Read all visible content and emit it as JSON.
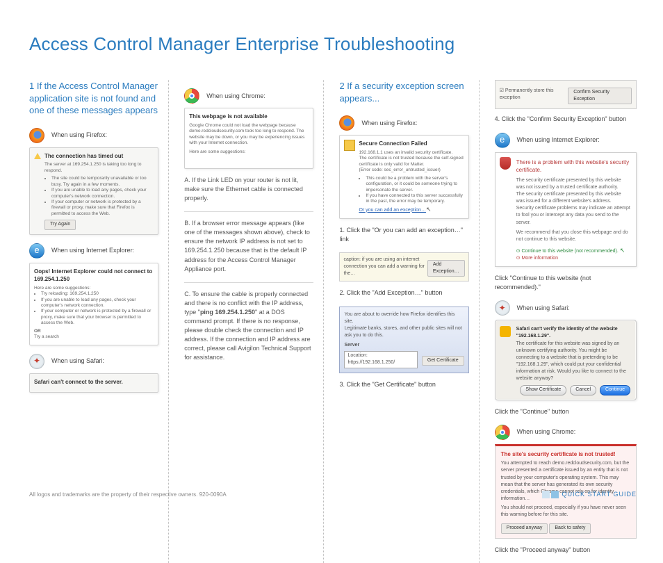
{
  "title": "Access Control Manager Enterprise Troubleshooting",
  "sec1": {
    "heading": "1 If the Access Control Manager application site is not found and one of these messages appears",
    "firefox_label": "When using Firefox:",
    "ie_label": "When using Internet Explorer:",
    "safari_label": "When using Safari:",
    "ff_shot_title": "The connection has timed out",
    "ff_shot_body": "The server at 169.254.1.250 is taking too long to respond.",
    "ff_shot_bul1": "The site could be temporarily unavailable or too busy. Try again in a few moments.",
    "ff_shot_bul2": "If you are unable to load any pages, check your computer's network connection.",
    "ff_shot_bul3": "If your computer or network is protected by a firewall or proxy, make sure that Firefox is permitted to access the Web.",
    "ff_shot_btn": "Try Again",
    "ie_shot_title": "Oops! Internet Explorer could not connect to 169.254.1.250",
    "ie_shot_sub": "Here are some suggestions:",
    "ie_shot_b1": "Try reloading: 169.254.1.250",
    "ie_shot_b2": "If you are unable to load any pages, check your computer's network connection.",
    "ie_shot_b3": "If your computer or network is protected by a firewall or proxy, make sure that your browser is permitted to access the Web.",
    "ie_shot_or": "OR",
    "ie_shot_try": "Try a search",
    "safari_shot_title": "Safari can't connect to the server."
  },
  "col2": {
    "chrome_label": "When using Chrome:",
    "cr_shot_title": "This webpage is not available",
    "cr_shot_body": "Google Chrome could not load the webpage because demo.redcloudsecurity.com took too long to respond. The website may be down, or you may be experiencing issues with your Internet connection.",
    "cr_shot_sub": "Here are some suggestions:",
    "noteA": "A.  If the Link LED on your router is not lit, make sure the Ethernet cable is connected properly.",
    "noteB": "B.  If a browser error message appears (like one of the messages shown above), check to ensure the network IP address is not set to 169.254.1.250 because that is the default IP address for the Access Control Manager Appliance port.",
    "noteC_pre": "C. To ensure the cable is properly connected and there is no conflict with the IP address, type \"",
    "noteC_cmd": "ping 169.254.1.250",
    "noteC_post": "\" at a DOS command prompt. If there is no response, please double check the connection and IP address.  If the connection and IP address are correct, please call Avigilon Technical Support for assistance."
  },
  "sec2": {
    "heading": "2 If a security exception screen appears...",
    "firefox_label": "When using Firefox:",
    "ff2_title": "Secure Connection Failed",
    "ff2_line1": "192.168.1.1 uses an invalid security certificate.",
    "ff2_line2": "The certificate is not trusted because the self-signed certificate is only valid for Matter.",
    "ff2_line3": "(Error code: sec_error_untrusted_issuer)",
    "ff2_b1": "This could be a problem with the server's configuration, or it could be someone trying to impersonate the server.",
    "ff2_b2": "If you have connected to this server successfully in the past, the error may be temporary.",
    "ff2_link": "Or you can add an exception…",
    "step1": "1. Click the \"Or you can add an exception…\" link",
    "bar_text": "caption: if you are using an internet connection you can add a warning for the…",
    "bar_btn": "Add Exception…",
    "step2": "2. Click the \"Add Exception…\" button",
    "gc_line1": "You are about to override how Firefox identifies this site.",
    "gc_line2": "Legitimate banks, stores, and other public sites will not ask you to do this.",
    "gc_loc_lbl": "Server",
    "gc_loc_val": "Location: https://192.168.1.250/",
    "gc_btn": "Get Certificate",
    "step3": "3. Click the \"Get Certificate\" button"
  },
  "col4": {
    "conf_chk": "☑ Permanently store this exception",
    "conf_btn": "Confirm Security Exception",
    "step4": "4. Click the \"Confirm Security Exception\" button",
    "ie_label": "When using Internet Explorer:",
    "ie_cap": "There is a problem with this website's security certificate.",
    "ie_txt1": "The security certificate presented by this website was not issued by a trusted certificate authority.",
    "ie_txt2": "The security certificate presented by this website was issued for a different website's address.",
    "ie_txt3": "Security certificate problems may indicate an attempt to fool you or intercept any data you send to the server.",
    "ie_txt4": "We recommend that you close this webpage and do not continue to this website.",
    "ie_go": "Continue to this website (not recommended).",
    "ie_more": "More information",
    "ie_step": "Click \"Continue to this website (not recommended).\"",
    "safari_label": "When using Safari:",
    "sf_title": "Safari can't verify the identity of the website \"192.168.1.29\".",
    "sf_body": "The certificate for this website was signed by an unknown certifying authority. You might be connecting to a website that is pretending to be \"192.168.1.29\", which could put your confidential information at risk. Would you like to connect to the website anyway?",
    "sf_b1": "Show Certificate",
    "sf_b2": "Cancel",
    "sf_b3": "Continue",
    "sf_step": "Click the \"Continue\" button",
    "chrome_label": "When using Chrome:",
    "cr2_title": "The site's security certificate is not trusted!",
    "cr2_body": "You attempted to reach demo.redcloudsecurity.com, but the server presented a certificate issued by an entity that is not trusted by your computer's operating system. This may mean that the server has generated its own security credentials, which Chrome cannot rely on for identity information…",
    "cr2_body2": "You should not proceed, especially if you have never seen this warning before for this site.",
    "cr2_b1": "Proceed anyway",
    "cr2_b2": "Back to safety",
    "cr2_step": "Click the \"Proceed anyway\" button"
  },
  "footer": {
    "legal": "All logos and trademarks are the property of their respective owners. 920-0090A",
    "guide": "QUICK START GUIDE"
  }
}
